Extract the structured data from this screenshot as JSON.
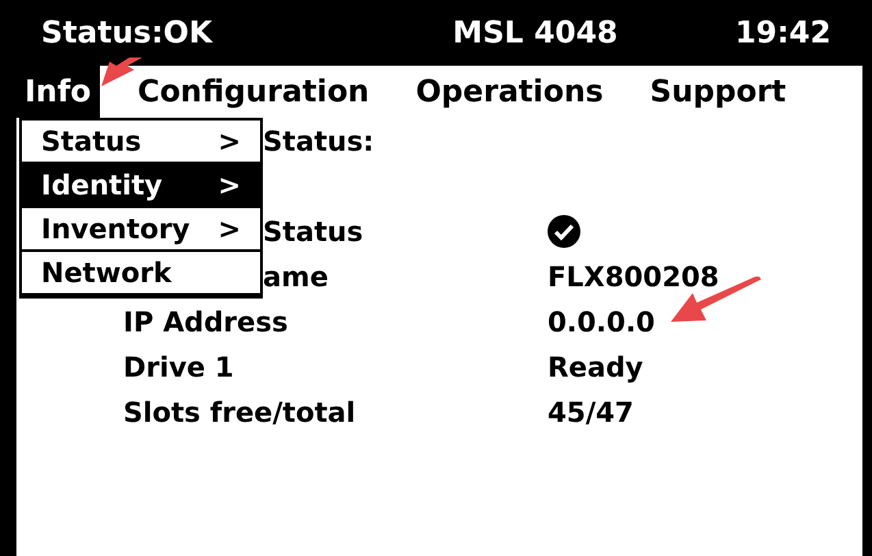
{
  "status_bar": {
    "status": "Status:OK",
    "title": "MSL 4048",
    "time": "19:42"
  },
  "menu_bar": [
    {
      "label": "Info",
      "selected": true
    },
    {
      "label": "Configuration",
      "selected": false
    },
    {
      "label": "Operations",
      "selected": false
    },
    {
      "label": "Support",
      "selected": false
    }
  ],
  "dropdown": [
    {
      "label": "Status",
      "arrow": ">",
      "selected": false
    },
    {
      "label": "Identity",
      "arrow": ">",
      "selected": true
    },
    {
      "label": "Inventory",
      "arrow": ">",
      "selected": false
    },
    {
      "label": "Network",
      "selected": false
    }
  ],
  "rows": [
    {
      "label": "Status:",
      "covered": true,
      "kind": "none"
    },
    {
      "kind": "blank"
    },
    {
      "label": "Status",
      "covered": true,
      "kind": "icon"
    },
    {
      "label": "ame",
      "covered": true,
      "kind": "text",
      "value": "FLX800208"
    },
    {
      "label": "IP Address",
      "covered": false,
      "kind": "text",
      "value": "0.0.0.0"
    },
    {
      "label": "Drive 1",
      "covered": false,
      "kind": "text",
      "value": "Ready"
    },
    {
      "label": "Slots free/total",
      "covered": false,
      "kind": "text",
      "value": "45/47"
    }
  ]
}
